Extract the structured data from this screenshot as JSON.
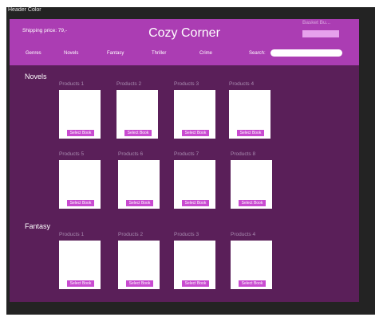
{
  "frame": {
    "label": "Header Color"
  },
  "header": {
    "shipping": "Shipping price: 79,-",
    "title": "Cozy Corner",
    "basket_label": "Basket Bu...",
    "nav": [
      "Genres",
      "Novels",
      "Fantasy",
      "Thriller",
      "Crime"
    ],
    "search_label": "Search:",
    "search_value": ""
  },
  "sections": [
    {
      "title": "Novels",
      "products": [
        {
          "label": "Products 1",
          "button": "Select Book"
        },
        {
          "label": "Products 2",
          "button": "Select Book"
        },
        {
          "label": "Products 3",
          "button": "Select Book"
        },
        {
          "label": "Products 4",
          "button": "Select Book"
        },
        {
          "label": "Products 5",
          "button": "Select Book"
        },
        {
          "label": "Products 6",
          "button": "Select Book"
        },
        {
          "label": "Products 7",
          "button": "Select Book"
        },
        {
          "label": "Products 8",
          "button": "Select Book"
        }
      ]
    },
    {
      "title": "Fantasy",
      "products": [
        {
          "label": "Products 1",
          "button": "Select Book"
        },
        {
          "label": "Products 2",
          "button": "Select Book"
        },
        {
          "label": "Products 3",
          "button": "Select Book"
        },
        {
          "label": "Products 4",
          "button": "Select Book"
        }
      ]
    }
  ],
  "colors": {
    "frame_bg": "#232323",
    "header": "#ab3db3",
    "page_bg": "#5a1f59",
    "card": "#ffffff",
    "select_button": "#c94bd1",
    "basket_button": "#e6a1ec"
  }
}
